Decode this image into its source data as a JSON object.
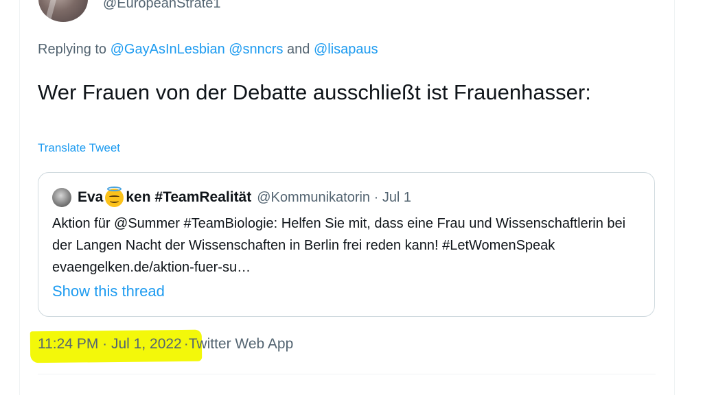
{
  "author": {
    "handle": "@EuropeanStrate1"
  },
  "reply": {
    "prefix": "Replying to ",
    "mention_1": "@GayAsInLesbian",
    "mention_2": "@snncrs",
    "conjunction": " and ",
    "mention_3": "@lisapaus"
  },
  "tweet": {
    "text": "Wer Frauen von der Debatte ausschließt ist Frauenhasser:",
    "translate_label": "Translate Tweet"
  },
  "quote": {
    "name_part_1": "Eva",
    "emoji": "smiling-face-with-halo",
    "name_part_2": "ken #TeamRealität",
    "handle_date": "@Kommunikatorin · Jul 1",
    "body": "Aktion für @Summer #TeamBiologie: Helfen Sie mit, dass eine Frau und Wissenschaftlerin bei der Langen Nacht der Wissenschaften in Berlin frei reden kann! #LetWomenSpeak evaengelken.de/aktion-fuer-su…",
    "show_thread_label": "Show this thread"
  },
  "footer": {
    "timestamp": "11:24 PM · Jul 1, 2022",
    "separator": " · ",
    "source": "Twitter Web App",
    "highlight_color": "#f3f80a"
  },
  "colors": {
    "link": "#1d9bf0",
    "secondary_text": "#536471",
    "primary_text": "#0f1419",
    "border": "#cfd9de"
  }
}
